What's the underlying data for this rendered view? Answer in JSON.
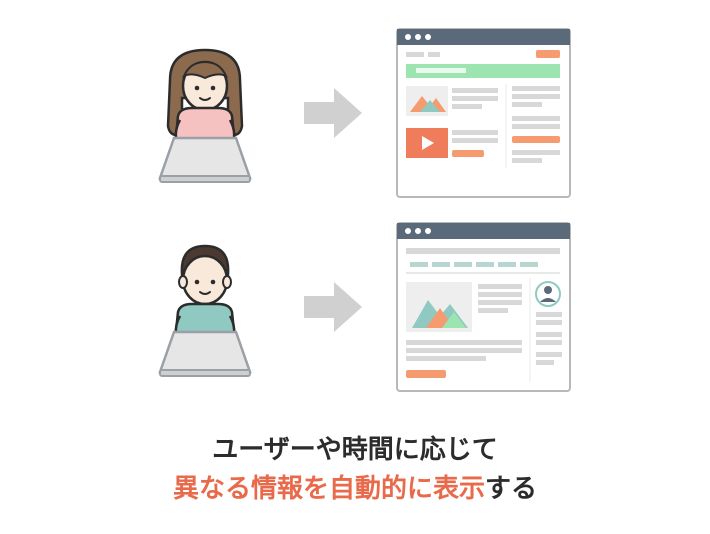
{
  "caption": {
    "line1": "ユーザーや時間に応じて",
    "line2_accent": "異なる情報を自動的に表示",
    "line2_rest": "する"
  },
  "colors": {
    "accent": "#e96a4b",
    "text": "#2c2c2c",
    "arrow": "#d0d0d0",
    "browser_border": "#b8b8b8",
    "browser_header": "#5a6a7a",
    "green_banner": "#9de5b0",
    "orange_btn": "#f59b6f",
    "teal": "#8fc9c2",
    "pink": "#f6c1c1",
    "skin": "#f9e9db",
    "hair_brown": "#8c6a4e",
    "hair_dark": "#4a3a32",
    "laptop": "#e6e6e6",
    "laptop_edge": "#9aa0a6",
    "placeholder": "#d8d8d8"
  }
}
